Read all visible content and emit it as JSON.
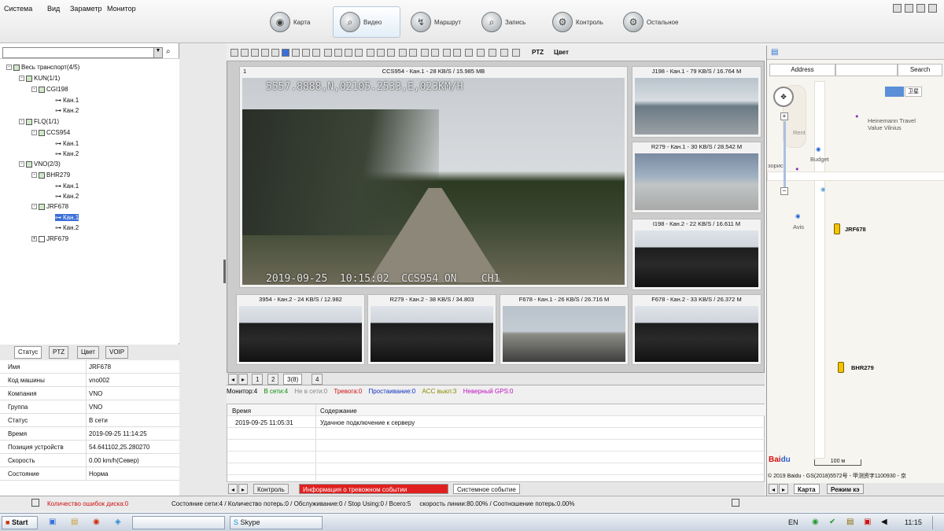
{
  "menu": {
    "items": [
      "Система",
      "Вид",
      "Зараметр",
      "Монитор"
    ]
  },
  "nav_tabs": [
    {
      "label": "Карта",
      "icon": "globe-icon"
    },
    {
      "label": "Видео",
      "icon": "magnifier-icon"
    },
    {
      "label": "Маршрут",
      "icon": "route-icon"
    },
    {
      "label": "Запись",
      "icon": "record-icon"
    },
    {
      "label": "Контроль",
      "icon": "control-icon"
    },
    {
      "label": "Остальное",
      "icon": "gear-icon"
    }
  ],
  "active_nav_tab": "Видео",
  "tree": {
    "root": "Весь транспорт(4/5)",
    "group1": "KUN(1/1)",
    "g1v1": "CGI198",
    "g1c1": "Кан.1",
    "g1c2": "Кан.2",
    "group2": "FLQ(1/1)",
    "g2v1": "CCS954",
    "g2c1": "Кан.1",
    "g2c2": "Кан.2",
    "group3": "VNO(2/3)",
    "g3v1": "BHR279",
    "g3v1c1": "Кан.1",
    "g3v1c2": "Кан.2",
    "g3v2": "JRF678",
    "g3v2c1": "Кан.1",
    "g3v2c2": "Кан.2",
    "g3v3": "JRF679"
  },
  "detail_tabs": [
    "Статус",
    "PTZ",
    "Цвет",
    "VOIP"
  ],
  "details": [
    {
      "k": "Имя",
      "v": "JRF678"
    },
    {
      "k": "Код машины",
      "v": "vno002"
    },
    {
      "k": "Компания",
      "v": "VNO"
    },
    {
      "k": "Группа",
      "v": "VNO"
    },
    {
      "k": "Статус",
      "v": "В сети"
    },
    {
      "k": "Время",
      "v": "2019-09-25 11:14:25"
    },
    {
      "k": "Позиция устройств",
      "v": "54.641102,25.280270"
    },
    {
      "k": "Скорость",
      "v": "0.00 km/h(Север)"
    },
    {
      "k": "Состояние",
      "v": "Норма"
    }
  ],
  "video_toolbar": {
    "ptz": "PTZ",
    "color": "Цвет"
  },
  "main_video": {
    "index": "1",
    "caption": "CCS954 - Кан.1 - 28 KB/S / 15.985 MB",
    "overlay_top": "5557.8888,N,02105.2533,E,023KM/H",
    "overlay_bottom": "2019-09-25  10:15:02  CCS954 ON    CH1"
  },
  "side_videos": [
    {
      "caption": "J198 - Кан.1 - 79 KB/S / 16.764 M"
    },
    {
      "caption": "R279 - Кан.1 - 30 KB/S / 28.542 M"
    },
    {
      "caption": "I198 - Кан.2 - 22 KB/S / 16.611 M"
    }
  ],
  "bottom_videos": [
    {
      "caption": "3954 - Кан.2 - 24 KB/S / 12.982"
    },
    {
      "caption": "R279 - Кан.2 - 38 KB/S / 34.803"
    },
    {
      "caption": "F678 - Кан.1 - 26 KB/S / 26.716 M"
    },
    {
      "caption": "F678 - Кан.2 - 33 KB/S / 26.372 M"
    }
  ],
  "page_tabs": [
    "1",
    "2",
    "3(8)",
    "4"
  ],
  "status_counts": [
    {
      "label": "Монитор:4",
      "color": "#000000"
    },
    {
      "label": "В сети:4",
      "color": "#0a8a0a"
    },
    {
      "label": "Не в сети:0",
      "color": "#888888"
    },
    {
      "label": "Тревога:0",
      "color": "#d01010"
    },
    {
      "label": "Простаивание:0",
      "color": "#1030c0"
    },
    {
      "label": "ACC выкл:3",
      "color": "#8a8a00"
    },
    {
      "label": "Неверный GPS:0",
      "color": "#c010c0"
    }
  ],
  "events": {
    "col_time": "Время",
    "col_content": "Содержание",
    "rows": [
      {
        "time": "2019-09-25 11:05:31",
        "content": "Удачное подключение к серверу"
      }
    ]
  },
  "event_tabs": [
    "Контроль",
    "Информация о тревожном событии",
    "Системное событие"
  ],
  "map": {
    "address_btn": "Address",
    "search_btn": "Search",
    "maptype_btn": "卫星",
    "pois": [
      "Heinemann Travel",
      "Value Vilnius",
      "Budget",
      "Avis",
      "Rent",
      "зорис"
    ],
    "vehicles": [
      "JRF678",
      "BHR279"
    ],
    "scale": "100 м",
    "copyright": "© 2019 Baidu - GS(2018)5572号 - 甲测资字1100930 - 京",
    "tabs": [
      "Карта",
      "Режим кэ"
    ]
  },
  "bottom_status": {
    "disk_errors": "Количество ошибок диска:0",
    "summary": "Состояние сети:4 / Количество потерь:0 / Обслуживание:0 / Stop Using:0 / Всего:5     скорость линии:80.00% / Соотношение потерь:0.00%"
  },
  "taskbar": {
    "start": "Start",
    "skype": "Skype",
    "lang": "EN",
    "time": "11:15"
  }
}
